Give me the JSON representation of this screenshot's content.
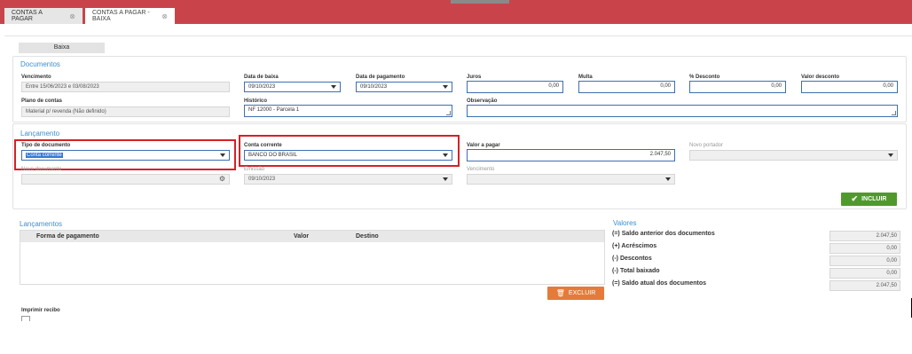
{
  "tabs": [
    {
      "label": "CONTAS A PAGAR",
      "close": "⊗"
    },
    {
      "label": "CONTAS A PAGAR - BAIXA",
      "close": "⊗"
    }
  ],
  "baixa_button": "Baixa",
  "documentos": {
    "title": "Documentos",
    "vencimento": {
      "label": "Vencimento",
      "value": "Entre 15/06/2023 e 03/08/2023"
    },
    "data_baixa": {
      "label": "Data de baixa",
      "value": "09/10/2023"
    },
    "data_pagamento": {
      "label": "Data de pagamento",
      "value": "09/10/2023"
    },
    "juros": {
      "label": "Juros",
      "value": "0,00"
    },
    "multa": {
      "label": "Multa",
      "value": "0,00"
    },
    "pct_desconto": {
      "label": "% Desconto",
      "value": "0,00"
    },
    "valor_desconto": {
      "label": "Valor desconto",
      "value": "0,00"
    },
    "plano_contas": {
      "label": "Plano de contas",
      "value": "Material p/ revenda (Não definido)"
    },
    "historico": {
      "label": "Histórico",
      "value": "NF 12000 - Parcela 1"
    },
    "observacao": {
      "label": "Observação",
      "value": ""
    }
  },
  "lancamento": {
    "title": "Lançamento",
    "tipo_documento": {
      "label": "Tipo de documento",
      "value": "Conta corrente"
    },
    "conta_corrente": {
      "label": "Conta corrente",
      "value": "BANCO DO BRASIL"
    },
    "valor_pagar": {
      "label": "Valor a pagar",
      "value": "2.047,50"
    },
    "novo_portador": {
      "label": "Novo portador",
      "value": ""
    },
    "novo_documento": {
      "label": "Novo documento",
      "value": ""
    },
    "emissao": {
      "label": "Emissão",
      "value": "09/10/2023"
    },
    "vencimento": {
      "label": "Vencimento",
      "value": ""
    },
    "incluir_label": "INCLUIR"
  },
  "lancamentos": {
    "title": "Lançamentos",
    "columns": [
      "Forma de pagamento",
      "Valor",
      "Destino"
    ],
    "excluir_label": "EXCLUIR"
  },
  "valores": {
    "title": "Valores",
    "rows": [
      {
        "label": "(=) Saldo anterior dos documentos",
        "value": "2.047,50"
      },
      {
        "label": "(+) Acréscimos",
        "value": "0,00"
      },
      {
        "label": "(-) Descontos",
        "value": "0,00"
      },
      {
        "label": "(-) Total baixado",
        "value": "0,00"
      },
      {
        "label": "(=) Saldo atual dos documentos",
        "value": "2.047,50"
      }
    ]
  },
  "imprimir_recibo": "Imprimir recibo",
  "colors": {
    "header": "#c9444a",
    "accent": "#3a8fd0",
    "incluir": "#4f9a2c",
    "excluir": "#e47b3b",
    "highlight": "#d62027"
  }
}
